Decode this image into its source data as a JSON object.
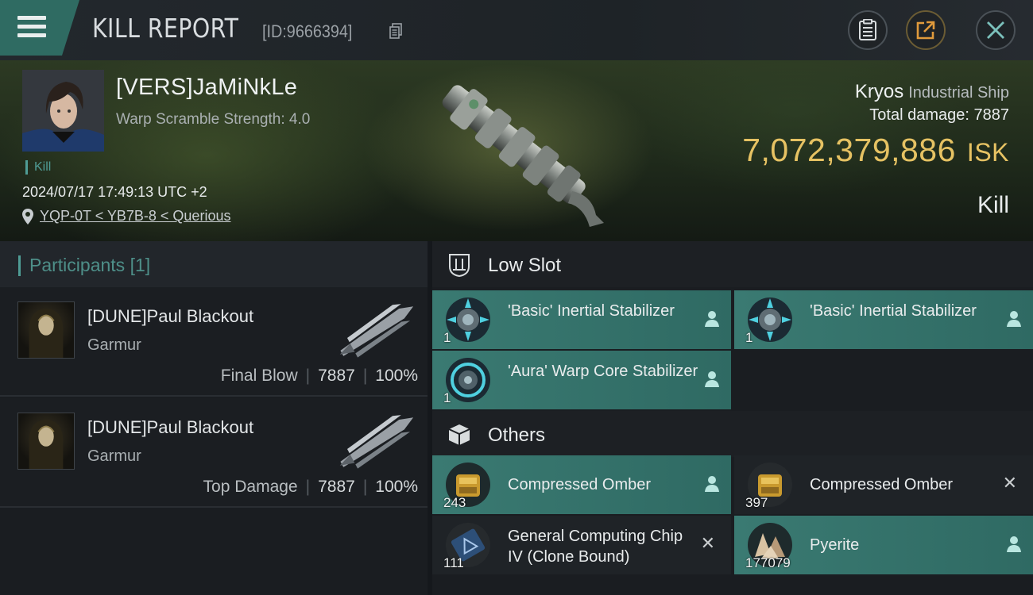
{
  "header": {
    "title": "KILL REPORT",
    "report_id": "[ID:9666394]"
  },
  "victim": {
    "name": "[VERS]JaMiNkLe",
    "warp_scramble": "Warp Scramble Strength: 4.0",
    "kill_tag": "Kill",
    "datetime": "2024/07/17 17:49:13 UTC +2",
    "location": "YQP-0T < YB7B-8 < Querious"
  },
  "ship": {
    "name": "Kryos",
    "class": "Industrial Ship",
    "damage_label": "Total damage:",
    "damage_value": "7887",
    "isk_value": "7,072,379,886",
    "isk_unit": "ISK",
    "result": "Kill"
  },
  "participants": {
    "label": "Participants",
    "count": "[1]",
    "rows": [
      {
        "name": "[DUNE]Paul Blackout",
        "ship": "Garmur",
        "role": "Final Blow",
        "damage": "7887",
        "percent": "100%"
      },
      {
        "name": "[DUNE]Paul Blackout",
        "ship": "Garmur",
        "role": "Top Damage",
        "damage": "7887",
        "percent": "100%"
      }
    ]
  },
  "sections": {
    "low_slot": {
      "title": "Low Slot",
      "items": [
        {
          "name": "'Basic' Inertial Stabilizer",
          "qty": "1",
          "status": "dropped",
          "icon": "inertial-stabilizer-icon"
        },
        {
          "name": "'Basic' Inertial Stabilizer",
          "qty": "1",
          "status": "dropped",
          "icon": "inertial-stabilizer-icon"
        },
        {
          "name": "'Aura' Warp Core Stabilizer",
          "qty": "1",
          "status": "dropped",
          "icon": "warp-core-stabilizer-icon"
        }
      ]
    },
    "others": {
      "title": "Others",
      "items": [
        {
          "name": "Compressed Omber",
          "qty": "243",
          "status": "dropped",
          "icon": "ore-omber-icon"
        },
        {
          "name": "Compressed Omber",
          "qty": "397",
          "status": "destroyed",
          "icon": "ore-omber-icon"
        },
        {
          "name": "General Computing Chip IV (Clone Bound)",
          "qty": "111",
          "status": "destroyed",
          "icon": "computing-chip-icon"
        },
        {
          "name": "Pyerite",
          "qty": "177079",
          "status": "dropped",
          "icon": "mineral-pyerite-icon"
        }
      ]
    }
  },
  "colors": {
    "accent_teal": "#2f6b62",
    "isk_gold": "#e6c263",
    "dropped_item_bg": "#3a7a72",
    "destroyed_item_bg": "#1f2327"
  }
}
